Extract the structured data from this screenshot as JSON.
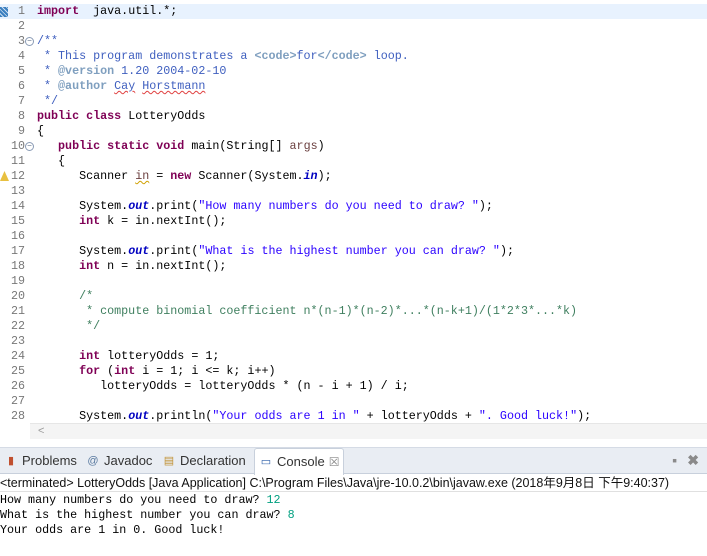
{
  "editor": {
    "lines": [
      {
        "n": "1",
        "fold": false,
        "current": true,
        "tokens": [
          [
            "kw",
            "import"
          ],
          [
            "",
            "  java.util.*;"
          ]
        ]
      },
      {
        "n": "2",
        "tokens": []
      },
      {
        "n": "3",
        "fold": true,
        "tokens": [
          [
            "jd",
            "/**"
          ]
        ]
      },
      {
        "n": "4",
        "tokens": [
          [
            "jd",
            " * This program demonstrates a "
          ],
          [
            "tag",
            "<code>"
          ],
          [
            "jd",
            "for"
          ],
          [
            "tag",
            "</code>"
          ],
          [
            "jd",
            " loop."
          ]
        ]
      },
      {
        "n": "5",
        "tokens": [
          [
            "jd",
            " * "
          ],
          [
            "tag",
            "@version"
          ],
          [
            "jd",
            " 1.20 2004-02-10"
          ]
        ]
      },
      {
        "n": "6",
        "tokens": [
          [
            "jd",
            " * "
          ],
          [
            "tag",
            "@author"
          ],
          [
            "jd",
            " "
          ],
          [
            "jd sp",
            "Cay"
          ],
          [
            "jd",
            " "
          ],
          [
            "jd sp",
            "Horstmann"
          ]
        ]
      },
      {
        "n": "7",
        "tokens": [
          [
            "jd",
            " */"
          ]
        ]
      },
      {
        "n": "8",
        "tokens": [
          [
            "kw",
            "public"
          ],
          [
            "",
            " "
          ],
          [
            "kw",
            "class"
          ],
          [
            "",
            " LotteryOdds"
          ]
        ]
      },
      {
        "n": "9",
        "tokens": [
          [
            "",
            "{"
          ]
        ]
      },
      {
        "n": "10",
        "fold": true,
        "tokens": [
          [
            "",
            "   "
          ],
          [
            "kw",
            "public"
          ],
          [
            "",
            " "
          ],
          [
            "kw",
            "static"
          ],
          [
            "",
            " "
          ],
          [
            "kw",
            "void"
          ],
          [
            "",
            " main(String[] "
          ],
          [
            "var",
            "args"
          ],
          [
            "",
            ")"
          ]
        ]
      },
      {
        "n": "11",
        "tokens": [
          [
            "",
            "   {"
          ]
        ]
      },
      {
        "n": "12",
        "warn": true,
        "tokens": [
          [
            "",
            "      Scanner "
          ],
          [
            "var wu",
            "in"
          ],
          [
            "",
            " = "
          ],
          [
            "kw",
            "new"
          ],
          [
            "",
            " Scanner(System."
          ],
          [
            "fs",
            "in"
          ],
          [
            "",
            ");"
          ]
        ]
      },
      {
        "n": "13",
        "tokens": []
      },
      {
        "n": "14",
        "tokens": [
          [
            "",
            "      System."
          ],
          [
            "fs",
            "out"
          ],
          [
            "",
            ".print("
          ],
          [
            "str",
            "\"How many numbers do you need to draw? \""
          ],
          [
            "",
            ");"
          ]
        ]
      },
      {
        "n": "15",
        "tokens": [
          [
            "",
            "      "
          ],
          [
            "kw",
            "int"
          ],
          [
            "",
            " k = in.nextInt();"
          ]
        ]
      },
      {
        "n": "16",
        "tokens": []
      },
      {
        "n": "17",
        "tokens": [
          [
            "",
            "      System."
          ],
          [
            "fs",
            "out"
          ],
          [
            "",
            ".print("
          ],
          [
            "str",
            "\"What is the highest number you can draw? \""
          ],
          [
            "",
            ");"
          ]
        ]
      },
      {
        "n": "18",
        "tokens": [
          [
            "",
            "      "
          ],
          [
            "kw",
            "int"
          ],
          [
            "",
            " n = in.nextInt();"
          ]
        ]
      },
      {
        "n": "19",
        "tokens": []
      },
      {
        "n": "20",
        "tokens": [
          [
            "cm",
            "      /*"
          ]
        ]
      },
      {
        "n": "21",
        "tokens": [
          [
            "cm",
            "       * compute binomial coefficient n*(n-1)*(n-2)*...*(n-k+1)/(1*2*3*...*k)"
          ]
        ]
      },
      {
        "n": "22",
        "tokens": [
          [
            "cm",
            "       */"
          ]
        ]
      },
      {
        "n": "23",
        "tokens": []
      },
      {
        "n": "24",
        "tokens": [
          [
            "",
            "      "
          ],
          [
            "kw",
            "int"
          ],
          [
            "",
            " lotteryOdds = 1;"
          ]
        ]
      },
      {
        "n": "25",
        "tokens": [
          [
            "",
            "      "
          ],
          [
            "kw",
            "for"
          ],
          [
            "",
            " ("
          ],
          [
            "kw",
            "int"
          ],
          [
            "",
            " i = 1; i <= k; i++)"
          ]
        ]
      },
      {
        "n": "26",
        "tokens": [
          [
            "",
            "         lotteryOdds = lotteryOdds * (n - i + 1) / i;"
          ]
        ]
      },
      {
        "n": "27",
        "tokens": []
      },
      {
        "n": "28",
        "tokens": [
          [
            "",
            "      System."
          ],
          [
            "fs",
            "out"
          ],
          [
            "",
            ".println("
          ],
          [
            "str",
            "\"Your odds are 1 in \""
          ],
          [
            "",
            " + lotteryOdds + "
          ],
          [
            "str",
            "\". Good luck!\""
          ],
          [
            "",
            ");"
          ]
        ]
      }
    ],
    "scroll_left_glyph": "<"
  },
  "panel": {
    "tabs": [
      {
        "label": "Problems",
        "icon": "problems-icon",
        "active": false
      },
      {
        "label": "Javadoc",
        "icon": "at-icon",
        "active": false
      },
      {
        "label": "Declaration",
        "icon": "declaration-icon",
        "active": false
      },
      {
        "label": "Console",
        "icon": "console-icon",
        "active": true
      }
    ],
    "close_glyph": "☒",
    "console_header": "<terminated> LotteryOdds [Java Application] C:\\Program Files\\Java\\jre-10.0.2\\bin\\javaw.exe (2018年9月8日 下午9:40:37)",
    "output": [
      {
        "text": "How many numbers do you need to draw? ",
        "input": "12"
      },
      {
        "text": "What is the highest number you can draw? ",
        "input": "8"
      },
      {
        "text": "Your odds are 1 in 0. Good luck!",
        "input": ""
      }
    ]
  }
}
